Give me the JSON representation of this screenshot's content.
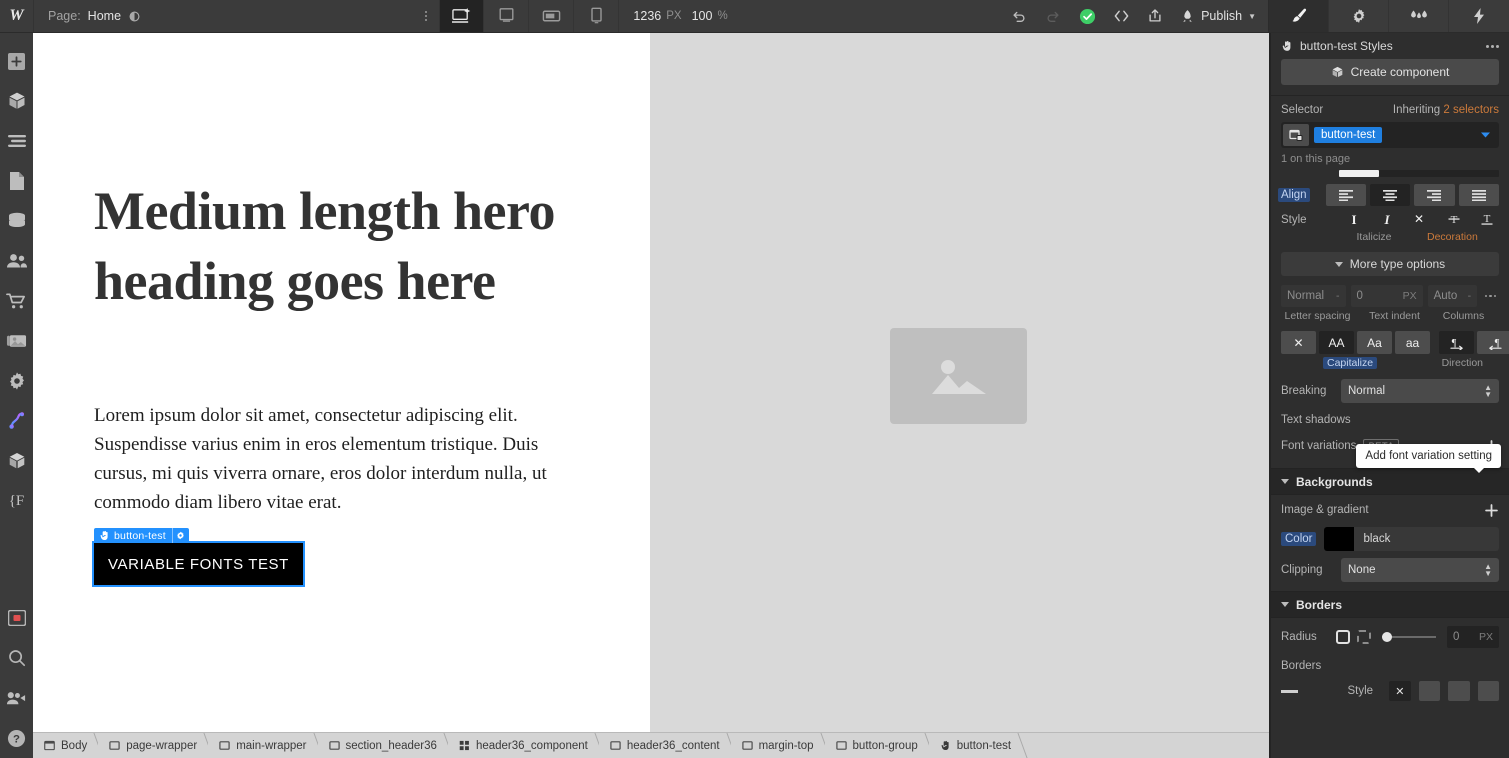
{
  "topbar": {
    "logo": "W",
    "page_label": "Page:",
    "page_name": "Home",
    "eye_icon": "eye-icon",
    "kebab_icon": "kebab-menu-icon",
    "devices": [
      {
        "name": "desktop",
        "icon": "desktop-icon",
        "active": true
      },
      {
        "name": "tablet",
        "icon": "tablet-icon",
        "active": false
      },
      {
        "name": "tablet-landscape",
        "icon": "tablet-landscape-icon",
        "active": false
      },
      {
        "name": "mobile",
        "icon": "mobile-icon",
        "active": false
      }
    ],
    "viewport_width": "1236",
    "viewport_unit": "PX",
    "zoom_value": "100",
    "zoom_unit": "%",
    "undo_icon": "undo-icon",
    "redo_icon": "redo-icon",
    "status_icon": "check-circle-icon",
    "status_color": "#3ece67",
    "code_icon": "code-brackets-icon",
    "share_icon": "share-export-icon",
    "rocket_icon": "rocket-icon",
    "publish_label": "Publish",
    "publish_caret": "chevron-down-icon",
    "right_tabs": [
      {
        "name": "style-panel",
        "icon": "paint-brush-icon",
        "active": true
      },
      {
        "name": "settings-panel",
        "icon": "gear-icon",
        "active": false
      },
      {
        "name": "style-manager-panel",
        "icon": "ink-drops-icon",
        "active": false
      },
      {
        "name": "interactions-panel",
        "icon": "lightning-bolt-icon",
        "active": false
      }
    ]
  },
  "leftrail": {
    "items": [
      {
        "name": "add-elements",
        "icon": "plus-icon"
      },
      {
        "name": "components",
        "icon": "cube-icon"
      },
      {
        "name": "navigator",
        "icon": "layers-icon"
      },
      {
        "name": "pages",
        "icon": "pages-icon"
      },
      {
        "name": "cms",
        "icon": "database-icon"
      },
      {
        "name": "users",
        "icon": "users-icon"
      },
      {
        "name": "ecommerce",
        "icon": "shopping-cart-icon"
      },
      {
        "name": "assets",
        "icon": "image-stack-icon"
      },
      {
        "name": "settings",
        "icon": "gear-icon"
      },
      {
        "name": "interactions",
        "icon": "interactions-icon"
      },
      {
        "name": "variables",
        "icon": "cube-outline-icon"
      },
      {
        "name": "code-variables",
        "icon": "brace-f-icon"
      }
    ],
    "bottom_items": [
      {
        "name": "video-record",
        "icon": "record-icon"
      },
      {
        "name": "search",
        "icon": "magnifier-icon"
      },
      {
        "name": "video-tutorials",
        "icon": "video-camera-icon"
      },
      {
        "name": "help",
        "icon": "question-circle-icon"
      }
    ]
  },
  "canvas": {
    "hero_heading": "Medium length hero heading goes here",
    "hero_body": "Lorem ipsum dolor sit amet, consectetur adipiscing elit. Suspendisse varius enim in eros elementum tristique. Duis cursus, mi quis viverra ornare, eros dolor interdum nulla, ut commodo diam libero vitae erat.",
    "selected_badge_label": "button-test",
    "selected_badge_icon": "hand-pointer-icon",
    "selected_badge_gear": "gear-icon",
    "button_label": "VARIABLE FONTS TEST",
    "button_bg": "#000000",
    "selection_color": "#2391fe",
    "image_placeholder_icon": "image-placeholder-icon"
  },
  "breadcrumb": {
    "items": [
      {
        "label": "Body",
        "icon": "body-icon"
      },
      {
        "label": "page-wrapper",
        "icon": "div-block-icon"
      },
      {
        "label": "main-wrapper",
        "icon": "div-block-icon"
      },
      {
        "label": "section_header36",
        "icon": "div-block-icon"
      },
      {
        "label": "header36_component",
        "icon": "grid-icon"
      },
      {
        "label": "header36_content",
        "icon": "div-block-icon"
      },
      {
        "label": "margin-top",
        "icon": "div-block-icon"
      },
      {
        "label": "button-group",
        "icon": "div-block-icon"
      },
      {
        "label": "button-test",
        "icon": "hand-pointer-icon"
      }
    ]
  },
  "stylepanel": {
    "title": "button-test Styles",
    "title_icon": "hand-pointer-icon",
    "more_icon": "ellipsis-icon",
    "create_component_label": "Create component",
    "create_component_icon": "cube-icon",
    "selector_label": "Selector",
    "inheriting_prefix": "Inheriting",
    "inheriting_count": "2 selectors",
    "selector_tag": "button-test",
    "selector_tag_icon": "element-icon",
    "selector_caret": "chevron-down-icon",
    "selector_count_text": "1 on this page",
    "typography": {
      "align_label": "Align",
      "align_options": [
        {
          "name": "align-left",
          "icon": "align-left-icon",
          "active": false
        },
        {
          "name": "align-center",
          "icon": "align-center-icon",
          "active": true
        },
        {
          "name": "align-right",
          "icon": "align-right-icon",
          "active": false
        },
        {
          "name": "align-justify",
          "icon": "align-justify-icon",
          "active": false
        }
      ],
      "style_label": "Style",
      "style_options": [
        {
          "name": "bold",
          "icon": "bold-icon",
          "active": true
        },
        {
          "name": "italic",
          "icon": "italic-icon",
          "active": false
        }
      ],
      "italicize_label": "Italicize",
      "decoration_options": [
        {
          "name": "decoration-none",
          "icon": "x-icon",
          "active": true
        },
        {
          "name": "decoration-strikethrough",
          "icon": "strikethrough-icon",
          "active": false
        },
        {
          "name": "decoration-underline",
          "icon": "underline-icon",
          "active": false
        },
        {
          "name": "decoration-overline",
          "icon": "overline-icon",
          "active": false
        }
      ],
      "decoration_label": "Decoration",
      "more_type_options_label": "More type options",
      "more_type_caret": "chevron-down-icon",
      "letter_spacing_value": "Normal",
      "letter_spacing_unit": "-",
      "letter_spacing_label": "Letter spacing",
      "text_indent_value": "0",
      "text_indent_unit": "PX",
      "text_indent_label": "Text indent",
      "columns_value": "Auto",
      "columns_unit": "-",
      "columns_label": "Columns",
      "columns_more_icon": "ellipsis-icon",
      "capitalize_options": [
        {
          "name": "caps-none",
          "icon": "x-icon",
          "label": "✕",
          "active": false
        },
        {
          "name": "caps-uppercase",
          "label": "AA",
          "active": true
        },
        {
          "name": "caps-capitalize",
          "label": "Aa",
          "active": false
        },
        {
          "name": "caps-lowercase",
          "label": "aa",
          "active": false
        }
      ],
      "capitalize_label": "Capitalize",
      "direction_options": [
        {
          "name": "direction-ltr",
          "icon": "direction-ltr-icon",
          "active": true
        },
        {
          "name": "direction-rtl",
          "icon": "direction-rtl-icon",
          "active": false
        }
      ],
      "direction_label": "Direction",
      "breaking_label": "Breaking",
      "breaking_value": "Normal",
      "text_shadows_label": "Text shadows",
      "font_variations_label": "Font variations",
      "font_variations_badge": "BETA",
      "font_variations_add_icon": "plus-icon",
      "tooltip_text": "Add font variation setting"
    },
    "backgrounds": {
      "section_label": "Backgrounds",
      "image_gradient_label": "Image & gradient",
      "image_gradient_add_icon": "plus-icon",
      "color_label": "Color",
      "color_value": "black",
      "color_hex": "#000000",
      "clipping_label": "Clipping",
      "clipping_value": "None"
    },
    "borders": {
      "section_label": "Borders",
      "radius_label": "Radius",
      "radius_all_icon": "radius-all-icon",
      "radius_individual_icon": "radius-corners-icon",
      "radius_value": "0",
      "radius_unit": "PX",
      "borders_label": "Borders",
      "style_label": "Style"
    }
  }
}
